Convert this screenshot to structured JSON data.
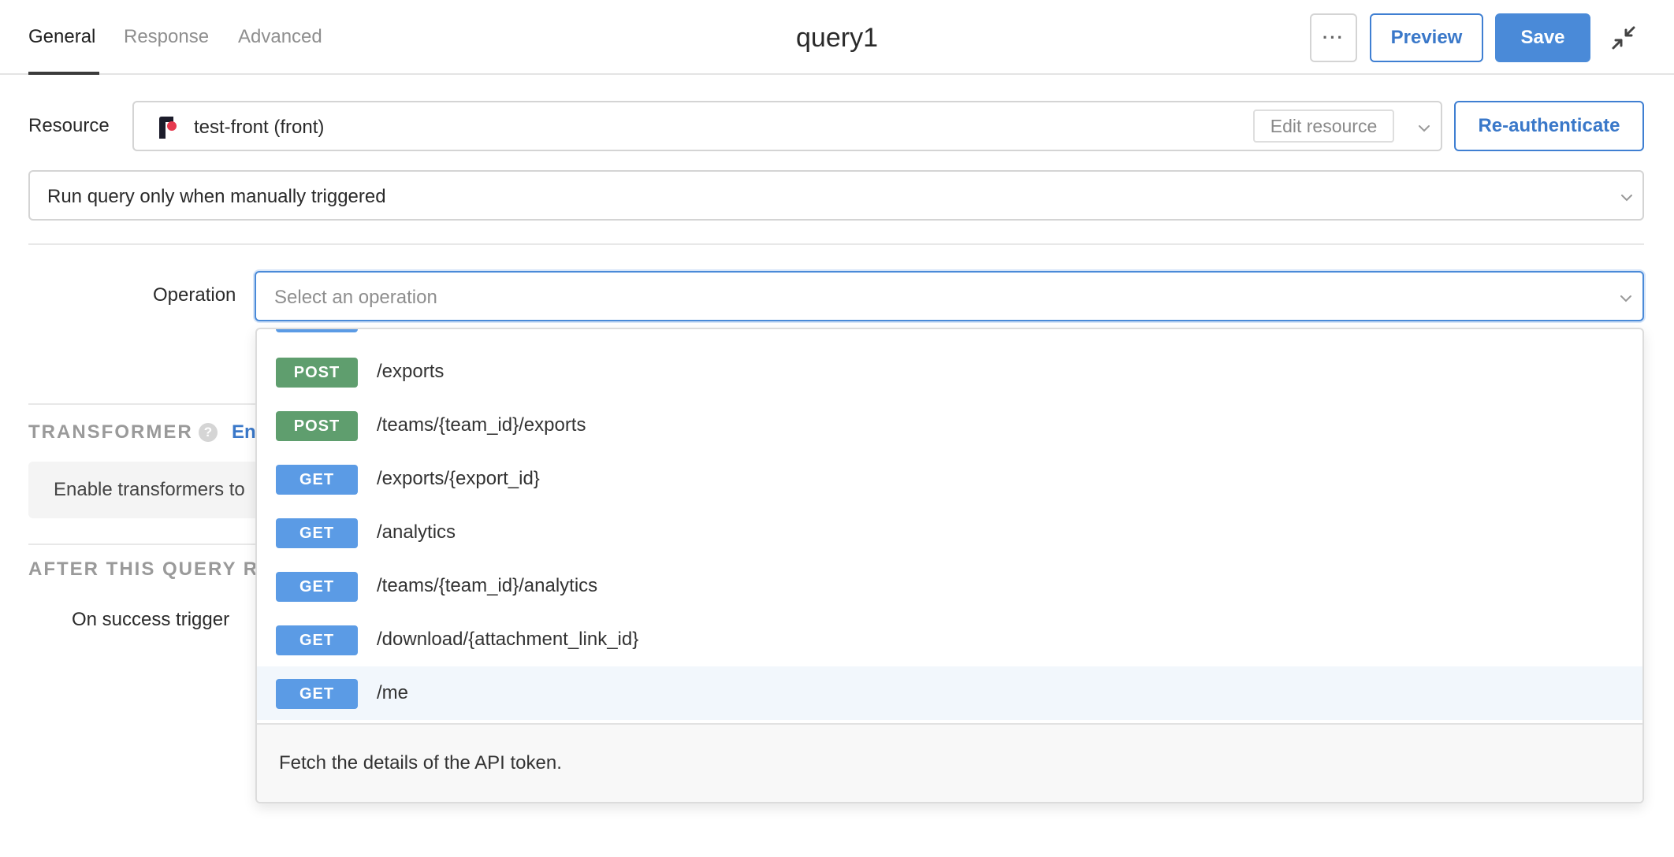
{
  "header": {
    "tabs": [
      {
        "label": "General",
        "active": true
      },
      {
        "label": "Response",
        "active": false
      },
      {
        "label": "Advanced",
        "active": false
      }
    ],
    "title": "query1",
    "more_label": "···",
    "preview_label": "Preview",
    "save_label": "Save"
  },
  "resource": {
    "label": "Resource",
    "value": "test-front (front)",
    "edit_label": "Edit resource",
    "reauth_label": "Re-authenticate"
  },
  "trigger": {
    "value": "Run query only when manually triggered"
  },
  "operation": {
    "label": "Operation",
    "placeholder": "Select an operation",
    "options": [
      {
        "method": "POST",
        "path": "/exports"
      },
      {
        "method": "POST",
        "path": "/teams/{team_id}/exports"
      },
      {
        "method": "GET",
        "path": "/exports/{export_id}"
      },
      {
        "method": "GET",
        "path": "/analytics"
      },
      {
        "method": "GET",
        "path": "/teams/{team_id}/analytics"
      },
      {
        "method": "GET",
        "path": "/download/{attachment_link_id}"
      },
      {
        "method": "GET",
        "path": "/me"
      }
    ],
    "highlighted_index": 6,
    "description": "Fetch the details of the API token."
  },
  "transformer": {
    "title": "TRANSFORMER",
    "help": "?",
    "enable_link": "En",
    "box_text": "Enable transformers to"
  },
  "after_query": {
    "title": "AFTER THIS QUERY RU",
    "success_label": "On success trigger"
  },
  "colors": {
    "accent": "#4a8ad8",
    "post_badge": "#5f9e6e",
    "get_badge": "#5b9be5"
  },
  "icons": {
    "more": "ellipsis-icon",
    "collapse": "collapse-arrows-icon",
    "resource_logo": "front-logo-icon",
    "dropdown": "chevron-down-icon",
    "help": "help-circle-icon"
  }
}
